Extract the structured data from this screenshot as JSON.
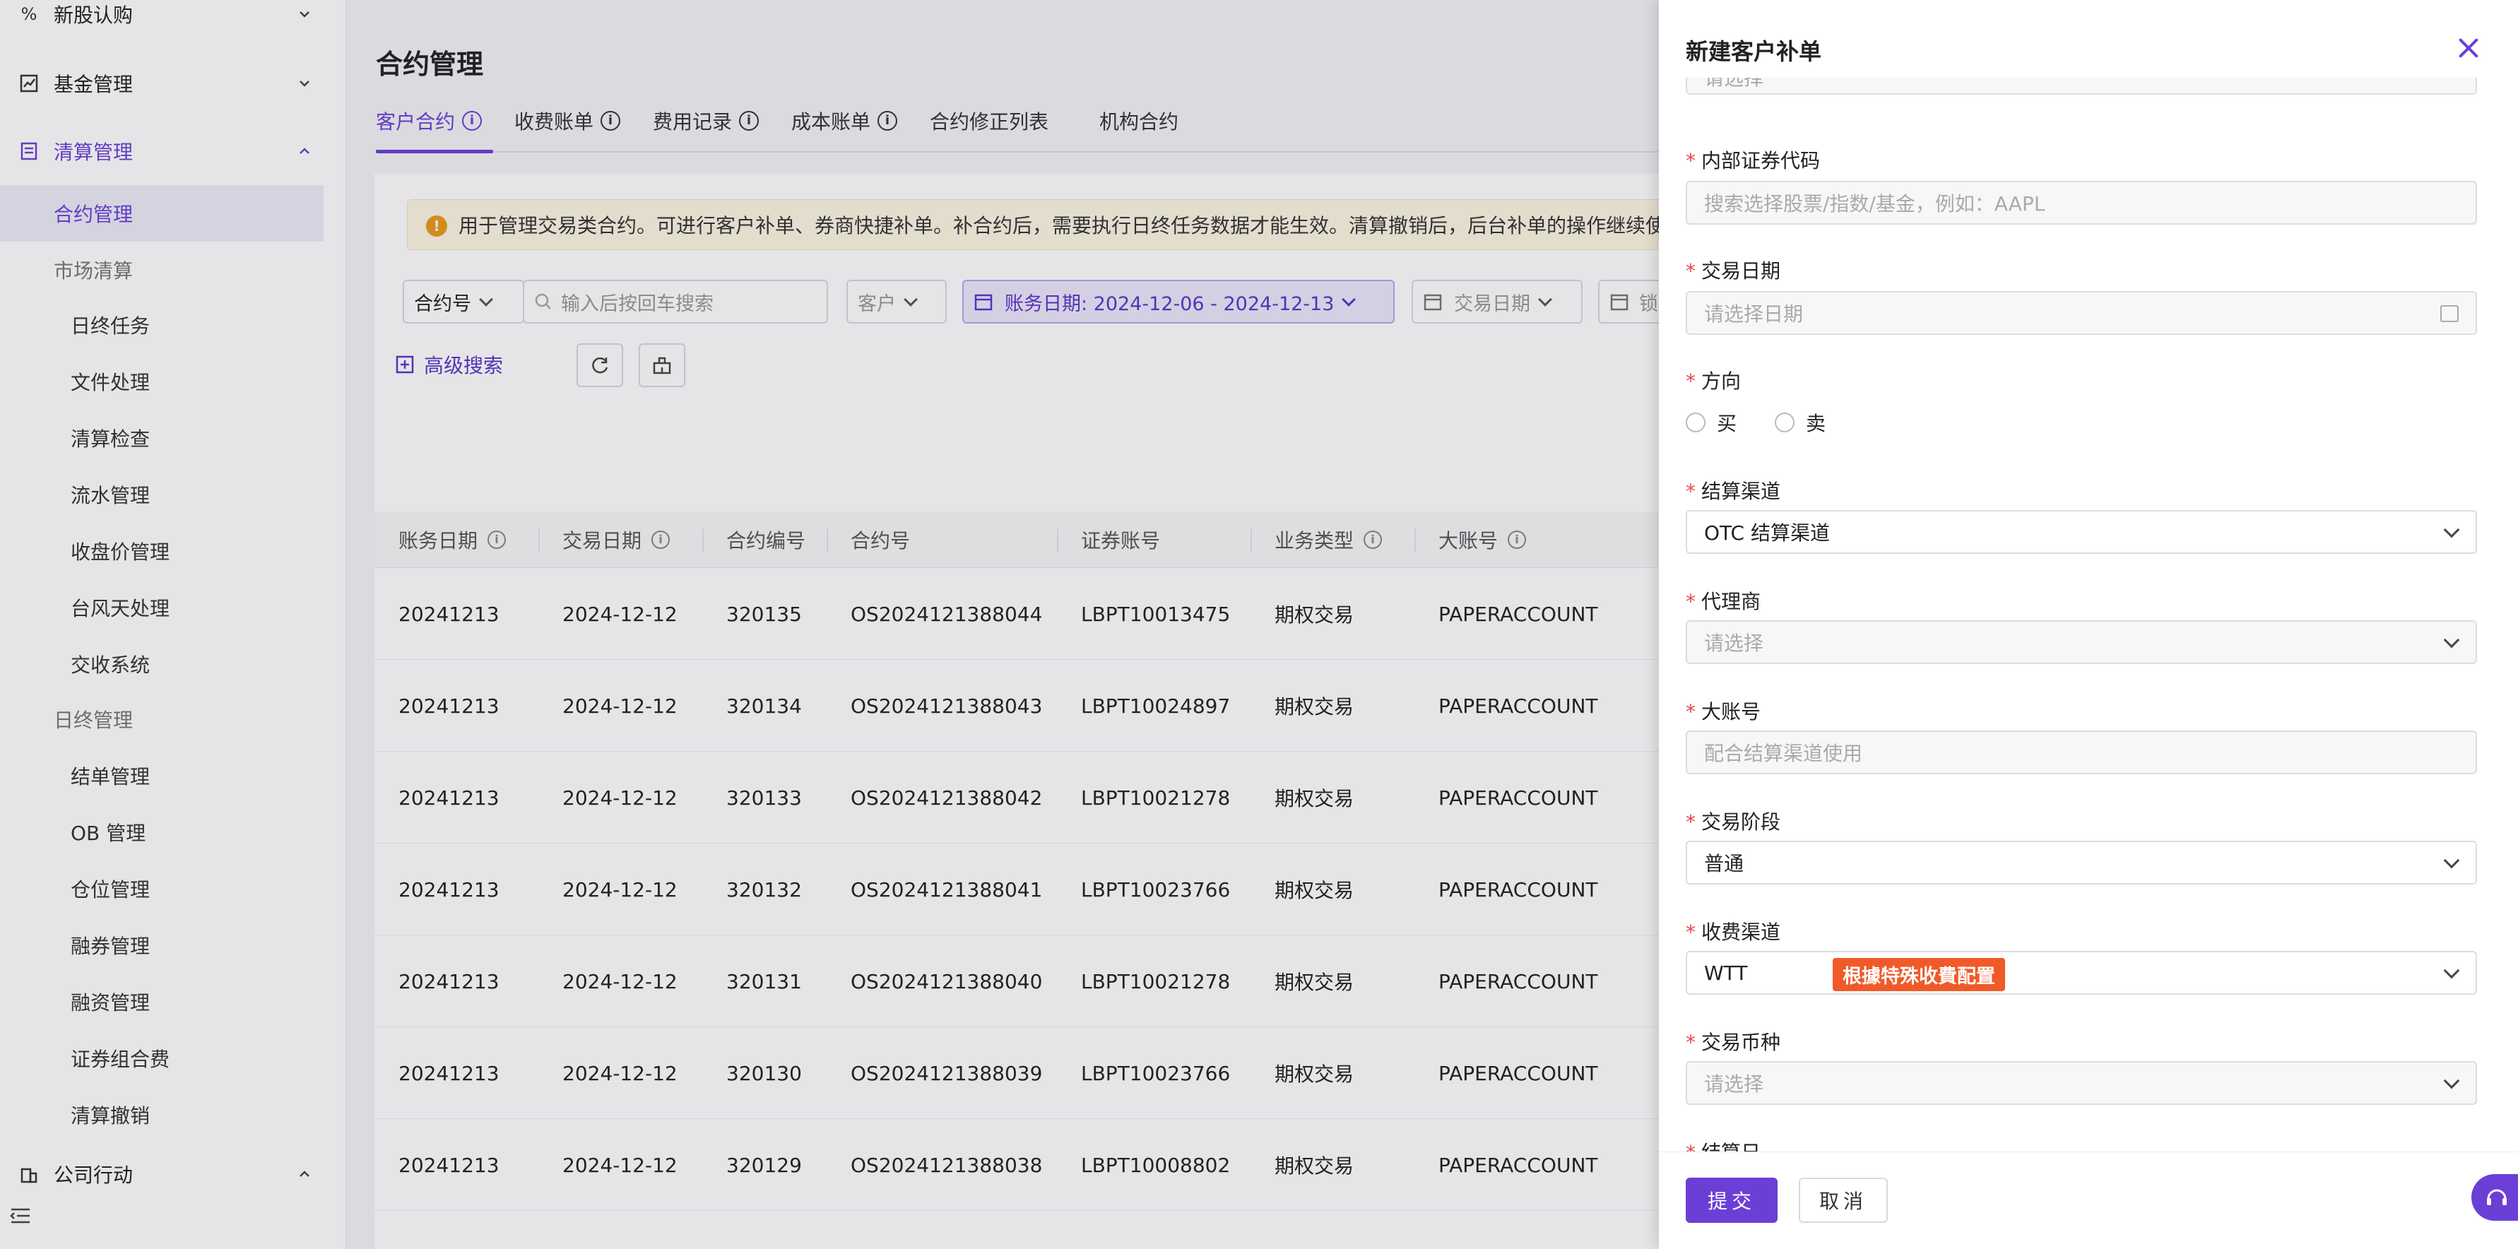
{
  "sidebar": {
    "top_items": [
      {
        "label": "新股认购"
      },
      {
        "label": "基金管理"
      },
      {
        "label": "清算管理"
      }
    ],
    "active_label": "合约管理",
    "group_market": "市场清算",
    "market_items": [
      "日终任务",
      "文件处理",
      "清算检查",
      "流水管理",
      "收盘价管理",
      "台风天处理",
      "交收系统"
    ],
    "group_eod": "日终管理",
    "eod_items": [
      "结单管理",
      "OB 管理",
      "仓位管理",
      "融券管理",
      "融资管理",
      "证券组合费",
      "清算撤销"
    ],
    "bottom_item": "公司行动"
  },
  "page": {
    "title": "合约管理",
    "tabs": [
      "客户合约",
      "收费账单",
      "费用记录",
      "成本账单",
      "合约修正列表",
      "机构合约"
    ],
    "alert": "用于管理交易类合约。可进行客户补单、券商快捷补单。补合约后，需要执行日终任务数据才能生效。清算撤销后，后台补单的操作继续使"
  },
  "filters": {
    "contract_select": "合约号",
    "search_placeholder": "输入后按回车搜索",
    "customer": "客户",
    "account_date": "账务日期: 2024-12-06 - 2024-12-13",
    "trade_date": "交易日期",
    "cut_label": "锁",
    "advanced": "高级搜索"
  },
  "table": {
    "headers": [
      "账务日期",
      "交易日期",
      "合约编号",
      "合约号",
      "证券账号",
      "业务类型",
      "大账号"
    ],
    "rows": [
      [
        "20241213",
        "2024-12-12",
        "320135",
        "OS2024121388044",
        "LBPT10013475",
        "期权交易",
        "PAPERACCOUNT"
      ],
      [
        "20241213",
        "2024-12-12",
        "320134",
        "OS2024121388043",
        "LBPT10024897",
        "期权交易",
        "PAPERACCOUNT"
      ],
      [
        "20241213",
        "2024-12-12",
        "320133",
        "OS2024121388042",
        "LBPT10021278",
        "期权交易",
        "PAPERACCOUNT"
      ],
      [
        "20241213",
        "2024-12-12",
        "320132",
        "OS2024121388041",
        "LBPT10023766",
        "期权交易",
        "PAPERACCOUNT"
      ],
      [
        "20241213",
        "2024-12-12",
        "320131",
        "OS2024121388040",
        "LBPT10021278",
        "期权交易",
        "PAPERACCOUNT"
      ],
      [
        "20241213",
        "2024-12-12",
        "320130",
        "OS2024121388039",
        "LBPT10023766",
        "期权交易",
        "PAPERACCOUNT"
      ],
      [
        "20241213",
        "2024-12-12",
        "320129",
        "OS2024121388038",
        "LBPT10008802",
        "期权交易",
        "PAPERACCOUNT"
      ]
    ]
  },
  "drawer": {
    "title": "新建客户补单",
    "top_cut_placeholder": "请选择",
    "code_label": "内部证券代码",
    "code_placeholder": "搜索选择股票/指数/基金，例如：AAPL",
    "date_label": "交易日期",
    "date_placeholder": "请选择日期",
    "direction_label": "方向",
    "buy": "买",
    "sell": "卖",
    "channel_label": "结算渠道",
    "channel_value": "OTC 结算渠道",
    "agent_label": "代理商",
    "agent_placeholder": "请选择",
    "bigacct_label": "大账号",
    "bigacct_placeholder": "配合结算渠道使用",
    "phase_label": "交易阶段",
    "phase_value": "普通",
    "fee_label": "收费渠道",
    "fee_value": "WTT",
    "fee_badge": "根據特殊收費配置",
    "currency_label": "交易币种",
    "currency_placeholder": "请选择",
    "cut_label": "结算日",
    "submit": "提交",
    "cancel": "取消"
  },
  "colors": {
    "accent": "#6a3fd6",
    "badge": "#f05a28",
    "required": "#e5484d"
  }
}
